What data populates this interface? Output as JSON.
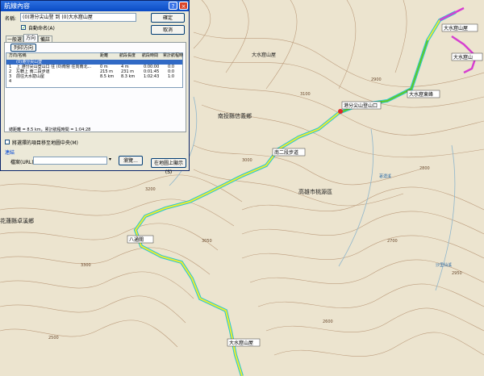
{
  "dialog": {
    "title": "航線內容",
    "name_label": "名稱:",
    "name_value": "(0)港分尖山登 到 (0)大水窟山屋",
    "auto_name_label": "自動命名(A)",
    "ok_label": "確定",
    "cancel_label": "取消",
    "tabs": [
      "一般選項",
      "方向",
      "備註"
    ],
    "reverse_button": "列印方向",
    "columns": [
      "方向/名稱",
      "距離",
      "航段長度",
      "航段時間",
      "累計航程時"
    ],
    "rows": [
      {
        "idx": "",
        "name": "(0)港分尖山登",
        "dist": "",
        "leg": "",
        "time": "",
        "total": ""
      },
      {
        "idx": "1",
        "name": "上 港分尖山登山口 往 (0)南營 往向南北...",
        "dist": "0 m",
        "leg": "4 m",
        "time": "0:00:00",
        "total": "0:0"
      },
      {
        "idx": "2",
        "name": "左轉上 南二段步道",
        "dist": "215 m",
        "leg": "231 m",
        "time": "0:01:45",
        "total": "0:0"
      },
      {
        "idx": "3",
        "name": "前往大水窟山屋",
        "dist": "8.5 km",
        "leg": "8.3 km",
        "time": "1:02:43",
        "total": "1:0"
      },
      {
        "idx": "4",
        "name": "",
        "dist": "",
        "leg": "",
        "time": "",
        "total": ""
      }
    ],
    "summary": "總距離 = 8.5 km，累計航程時間 = 1:04:28",
    "show_map_label": "將選擇的項目移至地圖中央(M)",
    "link_section": "連結",
    "file_label": "檔案(URL)：",
    "browse_button": "瀏覽...",
    "map_button": "在地圖上顯示(S)"
  },
  "map": {
    "labels": {
      "county_south": "南投縣信義鄉",
      "county_west": "花蓮縣卓溪鄉",
      "east_area": "高雄市桃源區",
      "grass_slope": "大水窟山屋",
      "shelter_top": "大水窟山屋",
      "start_point": "港分尖山登山口",
      "mid_point": "南二段步道",
      "junction1": "大水窟東峰",
      "junction2": "八通關",
      "bottom_point": "大水窟山屋",
      "peak_label": "大水窟山",
      "river1": "荖濃溪",
      "river2": "沙里仙溪"
    },
    "elevations": [
      "3000",
      "3100",
      "2900",
      "2800",
      "2700",
      "2600",
      "3200",
      "2500",
      "3300",
      "3050",
      "2950"
    ],
    "colors": {
      "track_yellow": "#f2ea2e",
      "track_green": "#59c92b",
      "track_magenta": "#d63fd0",
      "track_cyan": "#22c7d6",
      "contour": "#a0785a"
    }
  }
}
